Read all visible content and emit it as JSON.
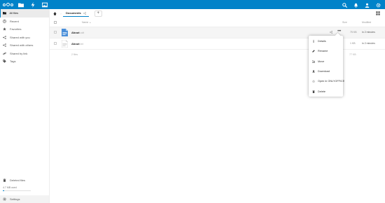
{
  "header": {
    "apps": [
      {
        "name": "files",
        "icon": "folder-icon"
      },
      {
        "name": "activity",
        "icon": "bolt-icon"
      },
      {
        "name": "gallery",
        "icon": "image-icon"
      }
    ],
    "right_icons": [
      "search-icon",
      "bell-icon",
      "contacts-icon",
      "gear-icon"
    ],
    "accent": "#0082c9"
  },
  "sidebar": {
    "items": [
      {
        "label": "All files",
        "icon": "folder-icon",
        "active": true
      },
      {
        "label": "Recent",
        "icon": "clock-icon"
      },
      {
        "label": "Favorites",
        "icon": "star-icon"
      },
      {
        "label": "Shared with you",
        "icon": "share-icon"
      },
      {
        "label": "Shared with others",
        "icon": "share-icon"
      },
      {
        "label": "Shared by link",
        "icon": "link-icon"
      },
      {
        "label": "Tags",
        "icon": "tag-icon"
      }
    ],
    "deleted": "Deleted files",
    "quota": "4.7 MB used",
    "quota_fraction": 0.05,
    "settings": "Settings"
  },
  "breadcrumb": {
    "current": "Documents",
    "new_label": "+"
  },
  "table": {
    "columns": {
      "name": "Name",
      "size": "Size",
      "modified": "Modified"
    },
    "rows": [
      {
        "name": "About",
        "ext": ".odt",
        "size": "75 KB",
        "modified": "in 2 minutes"
      },
      {
        "name": "About",
        "ext": ".txt",
        "size": "1 KB",
        "modified": "in 2 minutes"
      }
    ],
    "summary_count": "2 files",
    "summary_size": "77 KB"
  },
  "menu": {
    "items": [
      {
        "label": "Details",
        "icon": "info-icon"
      },
      {
        "label": "Rename",
        "icon": "pencil-icon"
      },
      {
        "label": "Move",
        "icon": "move-icon"
      },
      {
        "label": "Download",
        "icon": "download-icon"
      },
      {
        "label": "Open in ONLYOFFICE",
        "icon": "onlyoffice-icon"
      },
      {
        "label": "Delete",
        "icon": "trash-icon"
      }
    ]
  }
}
